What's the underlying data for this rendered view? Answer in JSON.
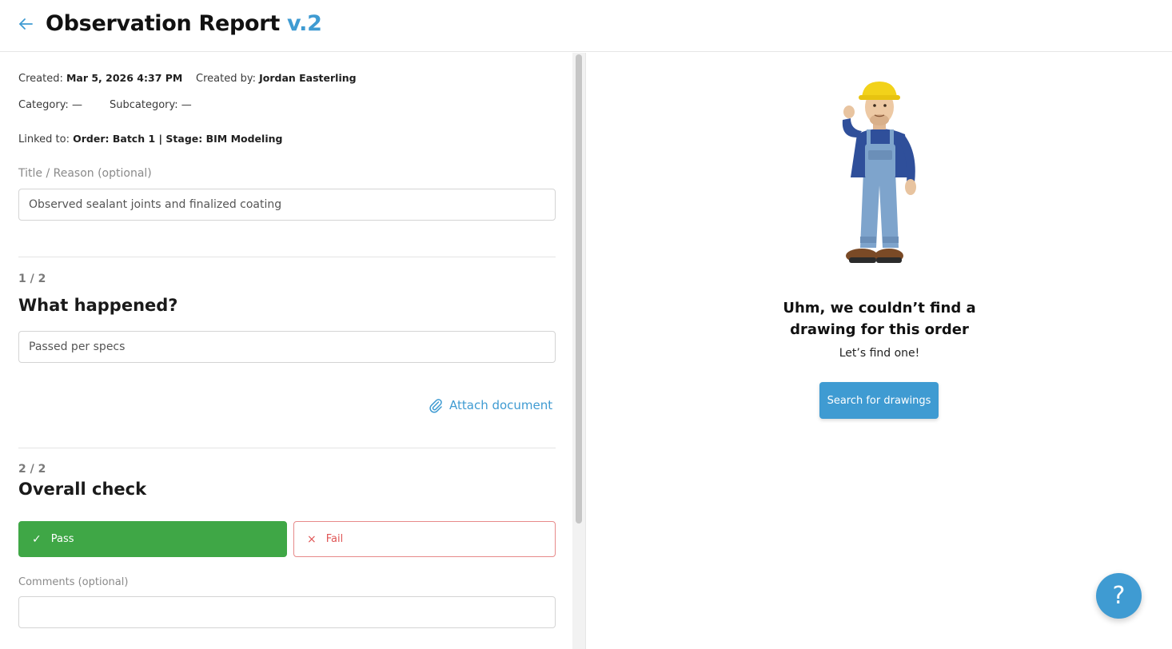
{
  "header": {
    "title": "Observation Report",
    "version": "v.2",
    "back_icon": "arrow-left-icon"
  },
  "meta": {
    "created_label": "Created:",
    "created_value": "Mar 5, 2026 4:37 PM",
    "created_by_label": "Created by:",
    "created_by_value": "Jordan Easterling",
    "category_label": "Category:",
    "category_value": "—",
    "subcategory_label": "Subcategory:",
    "subcategory_value": "—",
    "linked_label": "Linked to:",
    "linked_value": "Order: Batch 1 | Stage: BIM Modeling"
  },
  "title_field": {
    "label": "Title / Reason (optional)",
    "value": "Observed sealant joints and finalized coating"
  },
  "step1": {
    "counter": "1 / 2",
    "question": "What happened?",
    "answer": "Passed per specs",
    "attach_label": "Attach document",
    "attach_icon": "paperclip-icon"
  },
  "step2": {
    "counter": "2 / 2",
    "question": "Overall check",
    "pass_label": "Pass",
    "pass_glyph": "✓",
    "fail_label": "Fail",
    "fail_glyph": "×",
    "selected": "Pass",
    "comments_label": "Comments (optional)",
    "comments_value": ""
  },
  "empty_state": {
    "illustration": "construction-worker-illustration",
    "title": "Uhm, we couldn’t find a drawing for this order",
    "subtitle": "Let’s find one!",
    "button_label": "Search for drawings"
  },
  "help": {
    "glyph": "?"
  },
  "colors": {
    "accent": "#3f9bd2",
    "pass": "#3fa746",
    "fail": "#e05656"
  }
}
